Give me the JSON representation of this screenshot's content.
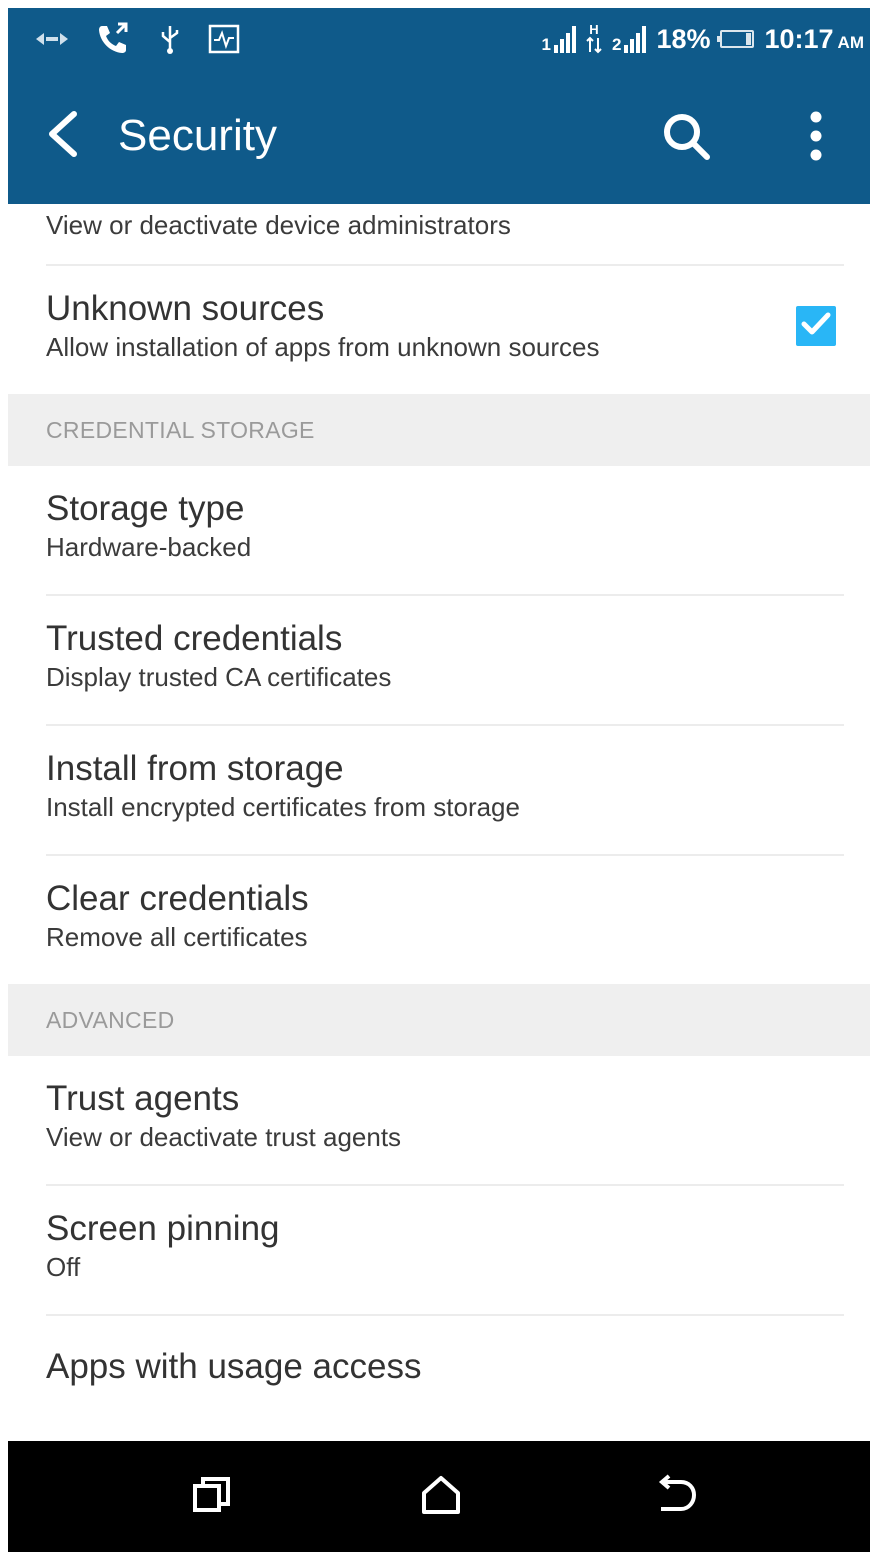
{
  "status_bar": {
    "sim1_label": "1",
    "sim2_label": "2",
    "network_type": "H",
    "battery_percent": "18%",
    "battery_level": 0.18,
    "time": "10:17",
    "ampm": "AM",
    "icons": [
      "data-arrows-icon",
      "call-icon",
      "usb-icon",
      "activity-icon",
      "signal-icon",
      "hspa-icon",
      "battery-icon"
    ]
  },
  "app_bar": {
    "title": "Security",
    "background": "#0f5a8a",
    "icons": [
      "back-arrow-icon",
      "search-icon",
      "more-vert-icon"
    ]
  },
  "list": {
    "top_partial_summary": "View or deactivate device administrators",
    "unknown_sources": {
      "title": "Unknown sources",
      "summary": "Allow installation of apps from unknown sources",
      "checked": true,
      "checkbox_color": "#29b6f6"
    },
    "section_credential_storage": "CREDENTIAL STORAGE",
    "storage_type": {
      "title": "Storage type",
      "summary": "Hardware-backed"
    },
    "trusted_credentials": {
      "title": "Trusted credentials",
      "summary": "Display trusted CA certificates"
    },
    "install_from_storage": {
      "title": "Install from storage",
      "summary": "Install encrypted certificates from storage"
    },
    "clear_credentials": {
      "title": "Clear credentials",
      "summary": "Remove all certificates"
    },
    "section_advanced": "ADVANCED",
    "trust_agents": {
      "title": "Trust agents",
      "summary": "View or deactivate trust agents"
    },
    "screen_pinning": {
      "title": "Screen pinning",
      "summary": "Off"
    },
    "apps_usage_access": {
      "title": "Apps with usage access"
    }
  },
  "nav_bar": {
    "icons": [
      "recent-apps-icon",
      "home-icon",
      "back-icon"
    ]
  }
}
